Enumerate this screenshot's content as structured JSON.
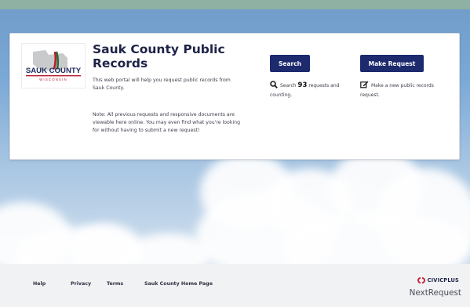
{
  "portal": {
    "title": "Sauk County Public Records",
    "logo_text": "SAUK COUNTY",
    "logo_subtext": "WISCONSIN",
    "description": "This web portal will help you request public records from Sauk County.",
    "note": "Note: All previous requests and responsive documents are viewable here online. You may even find what you're looking for without having to submit a new request!"
  },
  "actions": {
    "search_button": "Search",
    "search_text_prefix": "Search",
    "search_count": "93",
    "search_text_suffix": "requests and counting.",
    "request_button": "Make Request",
    "request_text": "Make a new public records request."
  },
  "footer": {
    "links": [
      "Help",
      "Privacy",
      "Terms",
      "Sauk County Home Page"
    ],
    "civicplus_label": "CIVICPLUS",
    "nextrequest_label": "NextRequest"
  },
  "colors": {
    "button_bg": "#1d2a6e",
    "title": "#1d2347",
    "civicplus_red": "#d0223c"
  },
  "icons": [
    "search-icon",
    "edit-icon",
    "civicplus-logo-icon"
  ]
}
